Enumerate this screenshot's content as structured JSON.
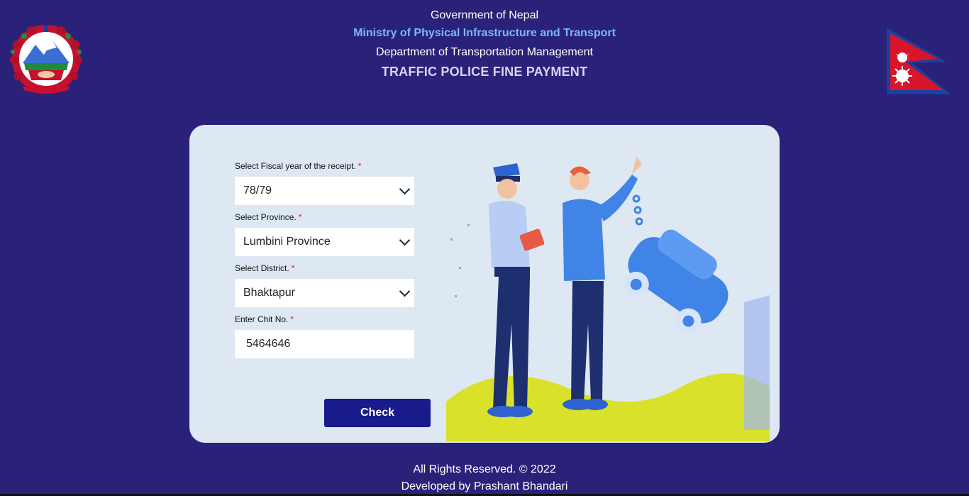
{
  "header": {
    "line1": "Government of Nepal",
    "line2": "Ministry of Physical Infrastructure and Transport",
    "line3": "Department of Transportation Management",
    "title": "TRAFFIC POLICE FINE PAYMENT"
  },
  "form": {
    "fiscal_label": "Select Fiscal year of the receipt.",
    "fiscal_value": "78/79",
    "province_label": "Select Province.",
    "province_value": "Lumbini Province",
    "district_label": "Select District.",
    "district_value": "Bhaktapur",
    "chit_label": "Enter Chit No.",
    "chit_value": "5464646",
    "required_mark": "*",
    "check_button": "Check"
  },
  "footer": {
    "rights": "All Rights Reserved. © 2022",
    "developer": "Developed by Prashant Bhandari"
  },
  "colors": {
    "background": "#2a2279",
    "card": "#dde8f2",
    "button": "#191a8c",
    "ministry_text": "#7ab8ff",
    "required": "#e02020"
  },
  "icons": [
    "nepal-emblem-icon",
    "nepal-flag-icon",
    "traffic-police-illustration"
  ]
}
